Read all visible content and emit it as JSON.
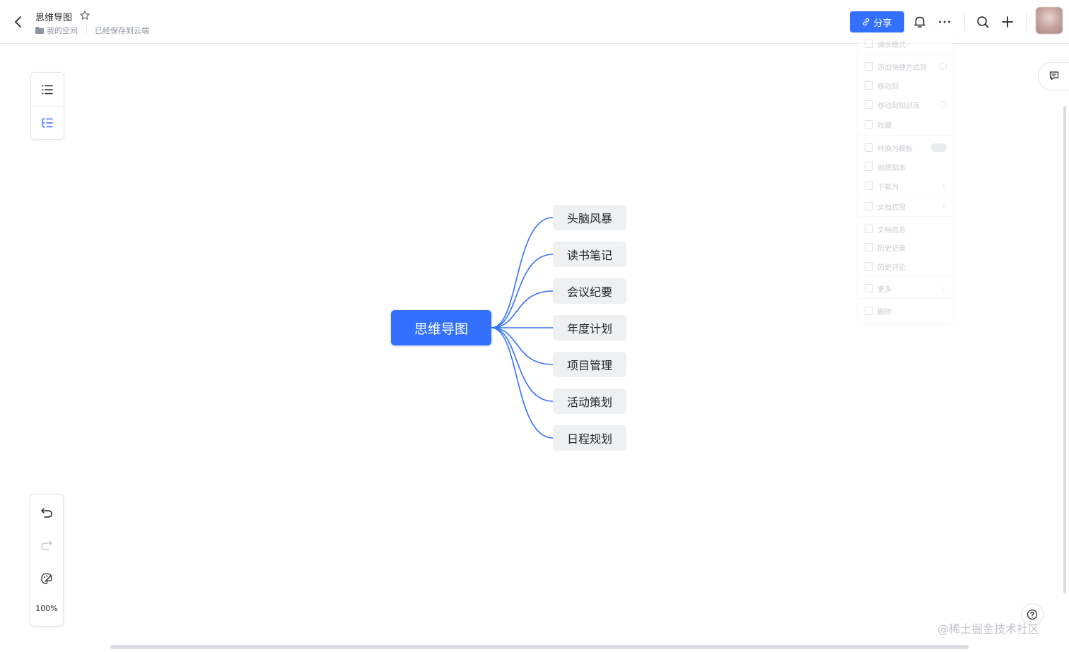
{
  "header": {
    "doc_title": "思维导图",
    "breadcrumb_space": "我的空间",
    "save_status": "已经保存到云端",
    "share_label": "分享",
    "icons": [
      "back-icon",
      "star-icon",
      "folder-icon",
      "link-icon",
      "bell-icon",
      "more-icon",
      "search-icon",
      "plus-icon"
    ]
  },
  "left_toolbar": {
    "top_buttons": [
      "outline-icon",
      "structure-icon"
    ],
    "bottom_buttons": [
      "undo-icon",
      "redo-icon",
      "style-icon"
    ],
    "zoom": "100%"
  },
  "mindmap": {
    "root": "思维导图",
    "children": [
      "头脑风暴",
      "读书笔记",
      "会议纪要",
      "年度计划",
      "项目管理",
      "活动策划",
      "日程规划"
    ],
    "link_color": "#3370ff",
    "root_color": "#3370ff",
    "child_bg": "#eff0f1"
  },
  "more_menu": {
    "items": [
      {
        "label": "演示模式"
      },
      {
        "label": "添加快捷方式到",
        "suffix": "help"
      },
      {
        "label": "移动到"
      },
      {
        "label": "移动到知识库",
        "suffix": "help"
      },
      {
        "label": "收藏"
      },
      {
        "label": "转换为模板",
        "suffix": "toggle"
      },
      {
        "label": "创建副本"
      },
      {
        "label": "下载为",
        "suffix": "chevron"
      },
      {
        "label": "文档权限",
        "suffix": "chevron"
      },
      {
        "label": "文档信息"
      },
      {
        "label": "历史记录"
      },
      {
        "label": "历史评论"
      },
      {
        "label": "更多",
        "suffix": "chevron"
      },
      {
        "label": "删除"
      }
    ]
  },
  "watermark": "@稀土掘金技术社区"
}
